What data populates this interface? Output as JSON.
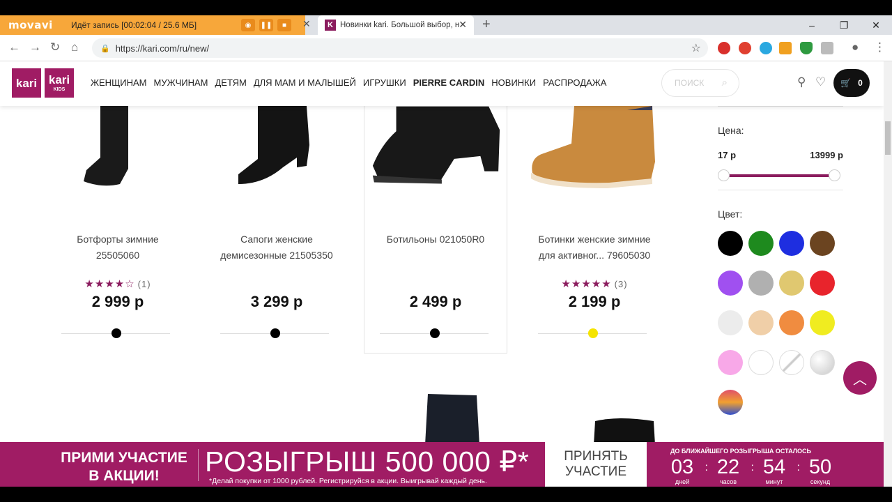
{
  "recorder": {
    "logo": "movavi",
    "status": "Идёт запись   [00:02:04 / 25.6 МБ]"
  },
  "browser": {
    "tab_title": "Новинки kari. Большой выбор, низкие цены",
    "tab_favicon": "K",
    "url": "https://kari.com/ru/new/"
  },
  "header": {
    "logo1": "kari",
    "logo2": "kari",
    "logo2_sub": "KIDS",
    "menu": [
      "ЖЕНЩИНАМ",
      "МУЖЧИНАМ",
      "ДЕТЯМ",
      "ДЛЯ МАМ И МАЛЫШЕЙ",
      "ИГРУШКИ",
      "PIERRE CARDIN",
      "НОВИНКИ",
      "РАСПРОДАЖА"
    ],
    "search_placeholder": "ПОИСК",
    "cart_count": "0"
  },
  "products": [
    {
      "name": "Ботфорты зимние 25505060",
      "stars": "★★★★☆",
      "reviews": "(1)",
      "price": "2 999 р",
      "color": "#000000"
    },
    {
      "name": "Сапоги женские демисезонные 21505350",
      "stars": "",
      "reviews": "",
      "price": "3 299 р",
      "color": "#000000"
    },
    {
      "name": "Ботильоны 021050R0",
      "stars": "",
      "reviews": "",
      "price": "2 499 р",
      "color": "#000000"
    },
    {
      "name": "Ботинки женские зимние для активног... 79605030",
      "stars": "★★★★★",
      "reviews": "(3)",
      "price": "2 199 р",
      "color": "#f5e400"
    }
  ],
  "filters": {
    "price_label": "Цена:",
    "price_min": "17 р",
    "price_max": "13999 р",
    "color_label": "Цвет:",
    "colors": [
      "#000000",
      "#1e8a1e",
      "#1e2ee0",
      "#6b4420",
      "#a050f0",
      "#b0b0b0",
      "#e0c870",
      "#e8242c",
      "#ececec",
      "#f0cfa8",
      "#f08c40",
      "#f0ec20",
      "#f8a8e8",
      "#ffffff",
      "none",
      "silver",
      "gradient"
    ]
  },
  "promo": {
    "left": "ПРИМИ УЧАСТИЕ В АКЦИИ!",
    "big": "РОЗЫГРЫШ 500 000 ₽*",
    "note": "*Делай покупки от 1000 рублей. Регистрируйся в акции. Выигрывай каждый день.",
    "cta": "ПРИНЯТЬ УЧАСТИЕ",
    "countdown_label": "ДО БЛИЖАЙШЕГО РОЗЫГРЫША ОСТАЛОСЬ",
    "timer": [
      {
        "value": "03",
        "unit": "дней"
      },
      {
        "value": "22",
        "unit": "часов"
      },
      {
        "value": "54",
        "unit": "минут"
      },
      {
        "value": "50",
        "unit": "секунд"
      }
    ]
  }
}
